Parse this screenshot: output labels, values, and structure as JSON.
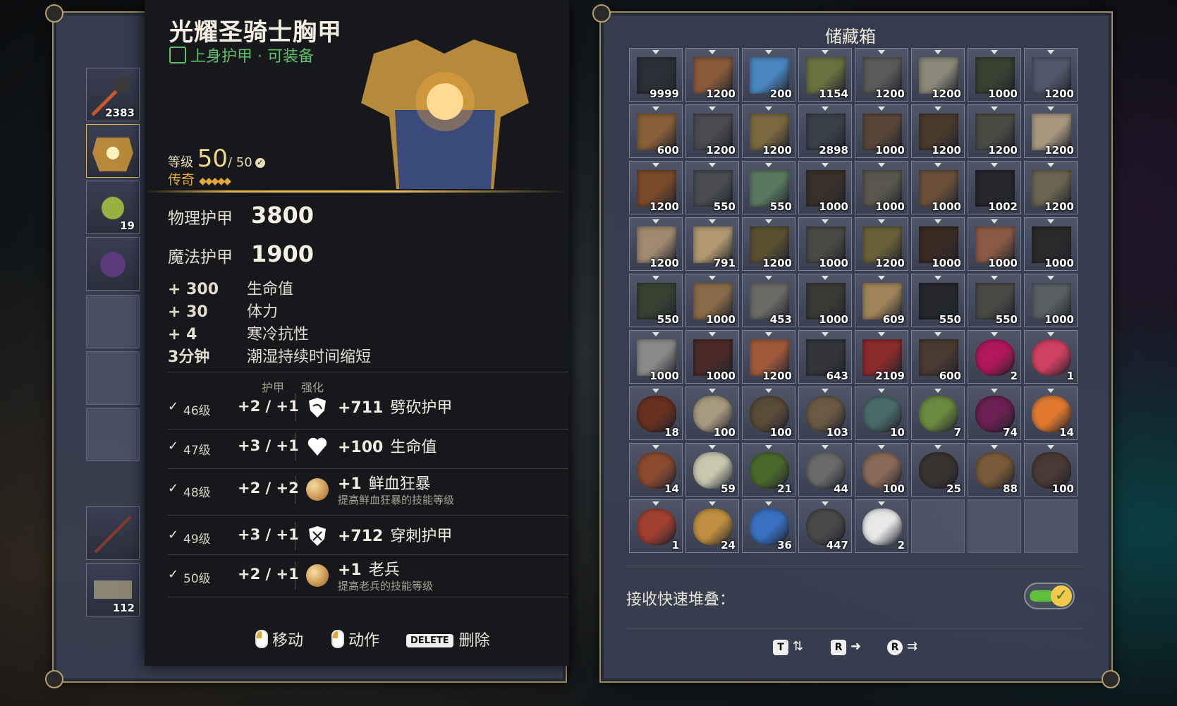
{
  "item": {
    "name": "光耀圣骑士胸甲",
    "type_label": "上身护甲 · 可装备",
    "level_label": "等级",
    "level": "50",
    "level_max": "/ 50",
    "rarity_label": "传奇",
    "stars": 5
  },
  "stats": {
    "physical_label": "物理护甲",
    "physical_value": "3800",
    "magic_label": "魔法护甲",
    "magic_value": "1900",
    "bonuses": [
      {
        "value": "+ 300",
        "label": "生命值"
      },
      {
        "value": "+ 30",
        "label": "体力"
      },
      {
        "value": "+ 4",
        "label": "寒冷抗性"
      },
      {
        "value": "3分钟",
        "label": "潮湿持续时间缩短"
      }
    ]
  },
  "upgrade_headers": {
    "armor": "护甲",
    "enhance": "强化"
  },
  "upgrades": [
    {
      "check": "✓",
      "level": "46级",
      "armor": "+2 / +1",
      "icon": "cleave-shield-icon",
      "bonus_value": "+711",
      "bonus_label": "劈砍护甲",
      "desc": ""
    },
    {
      "check": "✓",
      "level": "47级",
      "armor": "+3 / +1",
      "icon": "heart-icon",
      "bonus_value": "+100",
      "bonus_label": "生命值",
      "desc": ""
    },
    {
      "check": "✓",
      "level": "48级",
      "armor": "+2 / +2",
      "icon": "orb-icon",
      "bonus_value": "+1",
      "bonus_label": "鲜血狂暴",
      "desc": "提高鲜血狂暴的技能等级"
    },
    {
      "check": "✓",
      "level": "49级",
      "armor": "+3 / +1",
      "icon": "pierce-shield-icon",
      "bonus_value": "+712",
      "bonus_label": "穿刺护甲",
      "desc": ""
    },
    {
      "check": "✓",
      "level": "50级",
      "armor": "+2 / +1",
      "icon": "orb-icon",
      "bonus_value": "+1",
      "bonus_label": "老兵",
      "desc": "提高老兵的技能等级"
    }
  ],
  "footer": {
    "move": "移动",
    "action": "动作",
    "delete_key": "DELETE",
    "delete": "删除"
  },
  "equip_column": [
    {
      "count": "2383"
    },
    {
      "count": ""
    },
    {
      "count": "19"
    },
    {
      "count": ""
    },
    {
      "count": ""
    },
    {
      "count": "112"
    }
  ],
  "storage": {
    "title": "储藏箱",
    "receive_label": "接收快速堆叠：",
    "receive_enabled": true,
    "rows": [
      [
        "9999",
        "1200",
        "200",
        "1154",
        "1200",
        "1200",
        "1000",
        "1200"
      ],
      [
        "600",
        "1200",
        "1200",
        "2898",
        "1000",
        "1200",
        "1200",
        "1200"
      ],
      [
        "1200",
        "550",
        "550",
        "1000",
        "1000",
        "1000",
        "1002",
        "1200"
      ],
      [
        "1200",
        "791",
        "1200",
        "1000",
        "1200",
        "1000",
        "1000",
        "1000"
      ],
      [
        "550",
        "1000",
        "453",
        "1000",
        "609",
        "550",
        "550",
        "1000"
      ],
      [
        "1000",
        "1000",
        "1200",
        "643",
        "2109",
        "600",
        "2",
        "1"
      ],
      [
        "18",
        "100",
        "100",
        "103",
        "10",
        "7",
        "74",
        "14"
      ],
      [
        "14",
        "59",
        "21",
        "44",
        "100",
        "25",
        "88",
        "100"
      ],
      [
        "1",
        "24",
        "36",
        "447",
        "2",
        "",
        "",
        ""
      ]
    ],
    "colors": [
      [
        "#2c3036",
        "#8a5a3a",
        "#4a86c0",
        "#6a7040",
        "#5a5a58",
        "#8a8878",
        "#3a4030",
        "#50586a"
      ],
      [
        "#8a6038",
        "#4a4a50",
        "#7a6840",
        "#3a4048",
        "#5a4638",
        "#4a3a2c",
        "#4a4c44",
        "#a89880"
      ],
      [
        "#7a4a2a",
        "#4a4c52",
        "#5a7a60",
        "#3a302a",
        "#5a584c",
        "#6a5038",
        "#26262c",
        "#6a6450"
      ],
      [
        "#a08a70",
        "#b09870",
        "#5a5030",
        "#4a4a44",
        "#6a6038",
        "#3a2a22",
        "#8a5a44",
        "#2a2a2a"
      ],
      [
        "#3a4030",
        "#8a6a48",
        "#6a6a66",
        "#3a3a34",
        "#a08458",
        "#24262c",
        "#4a4a46",
        "#5a5e62"
      ],
      [
        "#8a8a88",
        "#4a2a26",
        "#a05a3a",
        "#34363a",
        "#8a2a2a",
        "#4a3a30",
        "#b0185a",
        "#d04060"
      ],
      [
        "#6a3020",
        "#a89a80",
        "#5a4a38",
        "#6a5a44",
        "#4a6a6a",
        "#6a8a40",
        "#6a2050",
        "#e07a30"
      ],
      [
        "#8a4a30",
        "#c8c8b0",
        "#4a6a2a",
        "#6a6a6a",
        "#8a6a58",
        "#3a3430",
        "#7a5a3a",
        "#4a3a34"
      ],
      [
        "#a04030",
        "#c09040",
        "#3a70c0",
        "#4a4a4a",
        "#e8e8e8",
        "",
        "",
        ""
      ]
    ]
  }
}
